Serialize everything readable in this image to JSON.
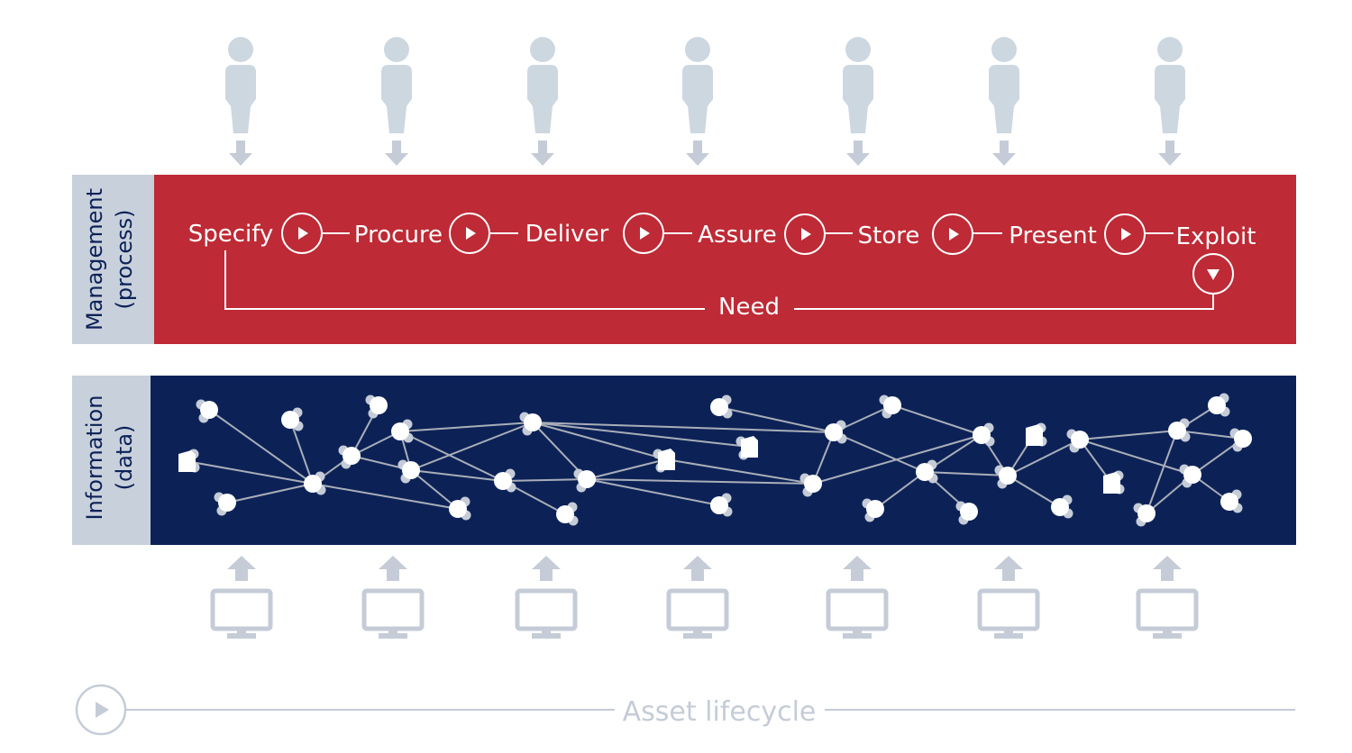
{
  "management": {
    "side_label_line1": "Management",
    "side_label_line2": "(process)",
    "steps": [
      "Specify",
      "Procure",
      "Deliver",
      "Assure",
      "Store",
      "Present",
      "Exploit"
    ],
    "feedback_label": "Need"
  },
  "information": {
    "side_label_line1": "Information",
    "side_label_line2": "(data)"
  },
  "footer": {
    "label": "Asset lifecycle"
  },
  "colors": {
    "management_band": "#be2a35",
    "information_band": "#0c2257",
    "side_label_bg": "#c8d0db",
    "icon_grey": "#c5ccd7",
    "text_dark": "#0c2257"
  },
  "icons": {
    "people": "person-icon",
    "computers": "monitor-icon",
    "flow": "play-circle-icon"
  }
}
